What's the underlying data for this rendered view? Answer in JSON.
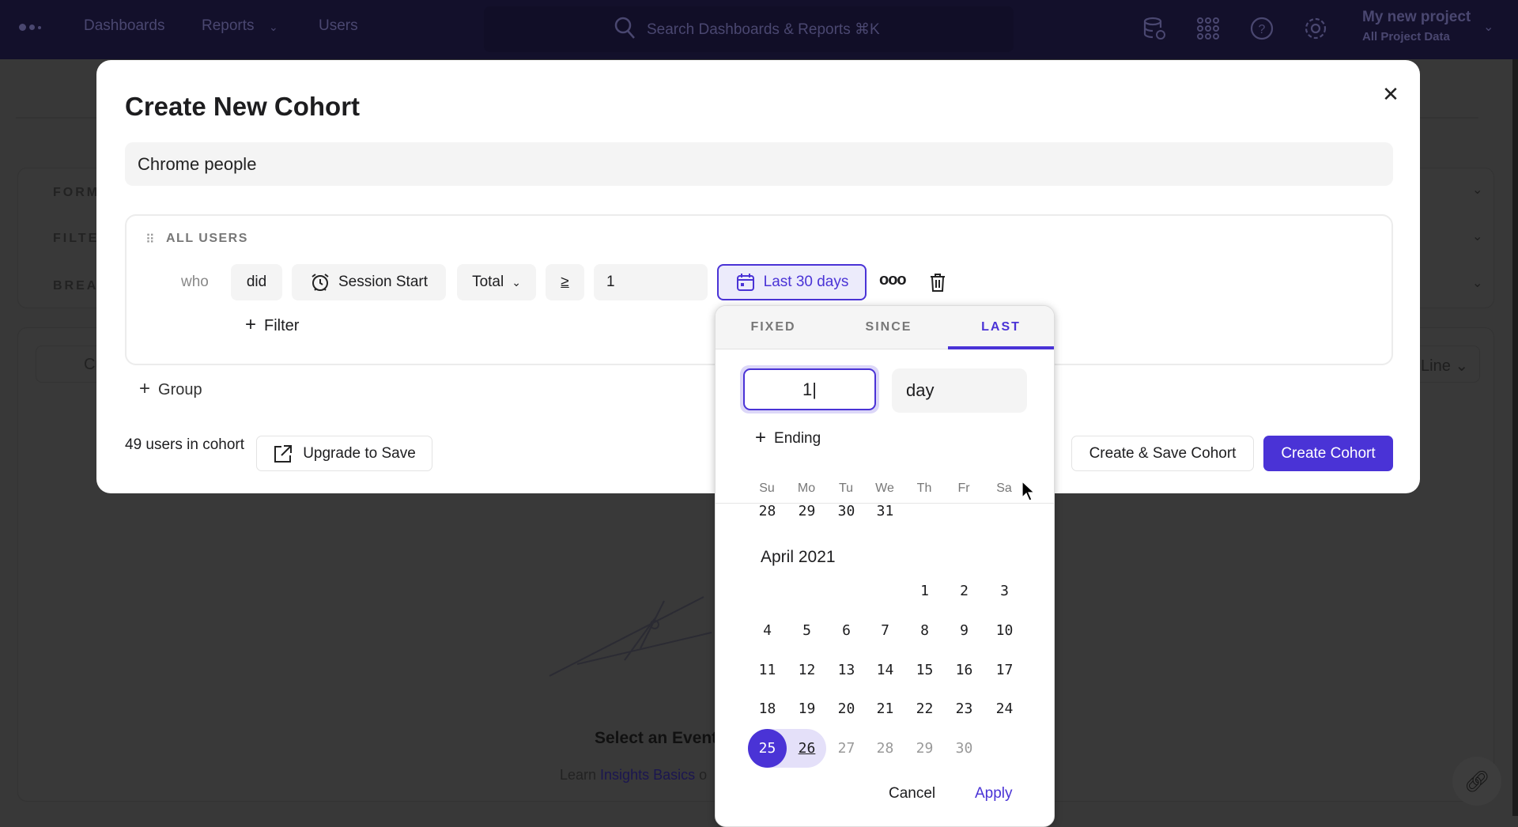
{
  "nav": {
    "items": [
      "Dashboards",
      "Reports",
      "Users"
    ],
    "search_placeholder": "Search Dashboards & Reports ⌘K",
    "project_name": "My new project",
    "project_sub": "All Project Data",
    "icons": [
      "database-icon",
      "apps-grid-icon",
      "help-icon",
      "settings-icon"
    ]
  },
  "background": {
    "sections": [
      "FORMULA",
      "FILTERS",
      "BREAKDOWN"
    ],
    "date_button": "Cu",
    "chart_type": "Line",
    "empty_title": "Select an Event",
    "learn_prefix": "Learn",
    "learn_link": "Insights Basics",
    "learn_suffix": "o"
  },
  "modal": {
    "title": "Create New Cohort",
    "cohort_name": "Chrome people",
    "group_label": "ALL USERS",
    "who": "who",
    "did": "did",
    "event": "Session Start",
    "aggregation": "Total",
    "operator": "≥",
    "count": "1",
    "date_range": "Last 30 days",
    "add_filter": "Filter",
    "add_group": "Group",
    "users_count": "49 users in cohort",
    "upgrade": "Upgrade to Save",
    "create_save": "Create & Save Cohort",
    "create": "Create Cohort"
  },
  "date_picker": {
    "tabs": [
      "FIXED",
      "SINCE",
      "LAST"
    ],
    "active_tab": "LAST",
    "last_value": "1",
    "unit": "day",
    "add_ending": "Ending",
    "weekdays": [
      "Su",
      "Mo",
      "Tu",
      "We",
      "Th",
      "Fr",
      "Sa"
    ],
    "prev_month_tail": [
      "28",
      "29",
      "30",
      "31"
    ],
    "month_label": "April 2021",
    "first_weekday": 4,
    "days_in_month": 30,
    "selected_start": 25,
    "selected_end": 26,
    "disabled_from": 27,
    "cancel": "Cancel",
    "apply": "Apply"
  },
  "colors": {
    "accent": "#4a33d6",
    "accent_light": "#e4e0f9",
    "nav_bg": "#13102b"
  }
}
